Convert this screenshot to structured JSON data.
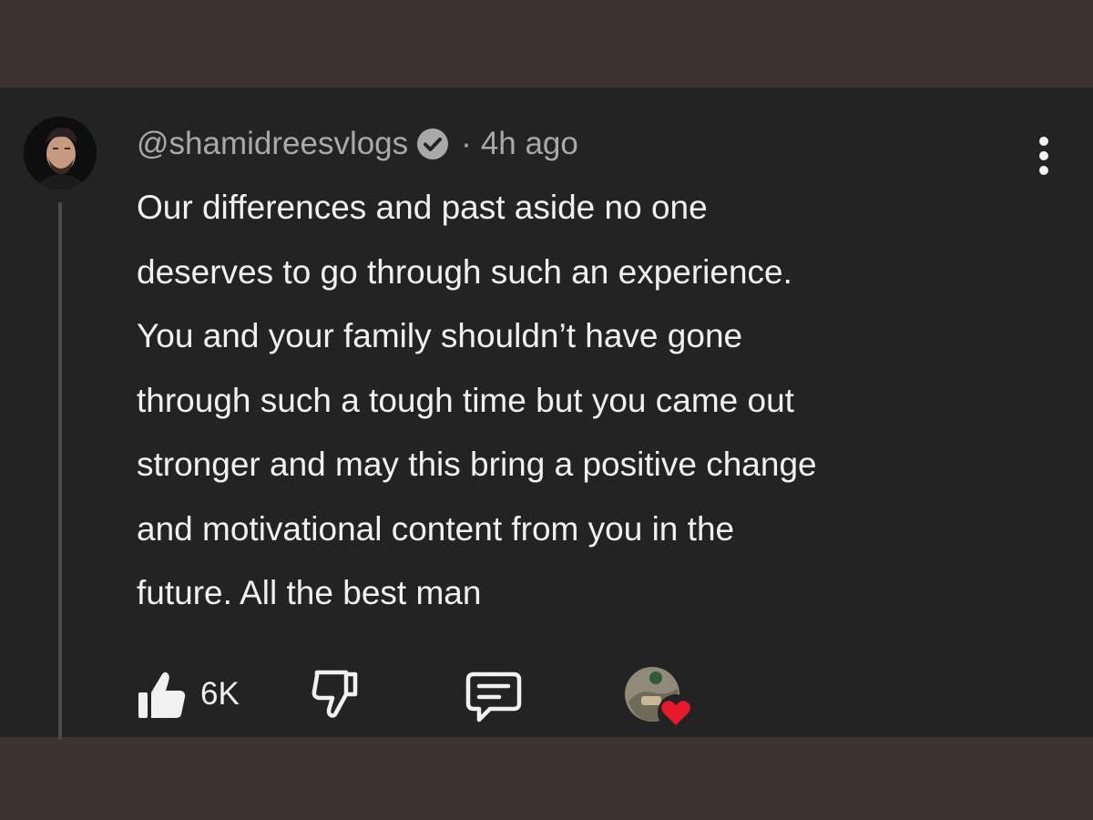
{
  "comment": {
    "username": "@shamidreesvlogs",
    "separator": "·",
    "timestamp": "4h ago",
    "lines": [
      "Our differences and past aside no one",
      "deserves to go through such an experience.",
      "You and your family shouldn’t have gone",
      "through such a tough time but you came out",
      "stronger and may this bring a positive change",
      "and motivational content from you in the",
      "future. All the best man"
    ],
    "like_count": "6K"
  },
  "icons": {
    "verified": "verified-check-icon",
    "more": "more-vert-icon",
    "like": "thumbs-up-icon",
    "dislike": "thumbs-down-icon",
    "reply": "comment-reply-icon",
    "heart": "heart-icon"
  },
  "colors": {
    "panel_bg": "#232323",
    "outer_bg": "#3b3330",
    "text_primary": "#f1f1f1",
    "text_secondary": "#a9a9a9",
    "heart": "#e8192c"
  }
}
